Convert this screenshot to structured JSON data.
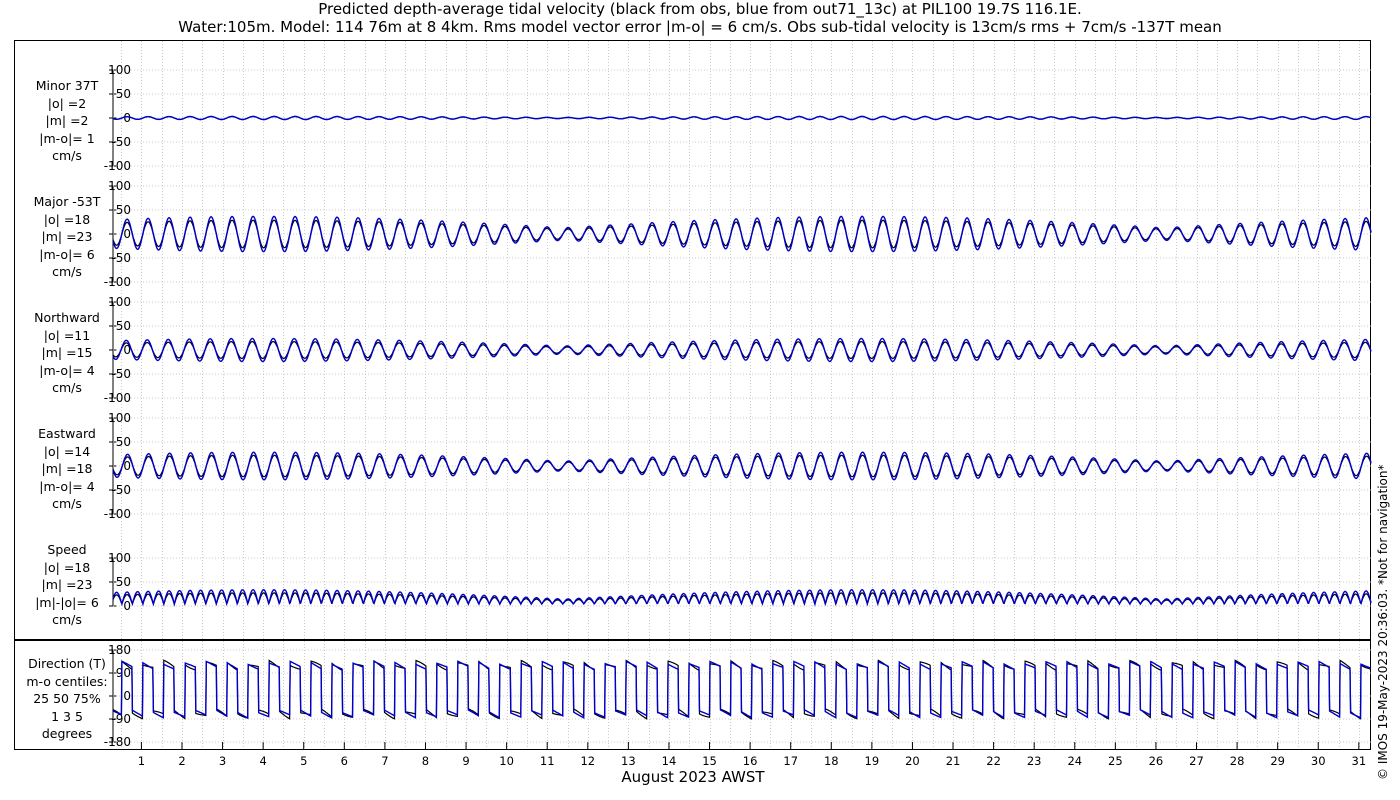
{
  "title_line1": "Predicted depth-average tidal velocity (black from obs, blue from out71_13c) at PIL100 19.7S 116.1E.",
  "title_line2": "Water:105m. Model: 114 76m at 8 4km. Rms model vector error |m-o| = 6 cm/s. Obs sub-tidal velocity is 13cm/s rms + 7cm/s -137T mean",
  "credit": "© IMOS 19-May-2023 20:36:03.  *Not for navigation*",
  "colors": {
    "obs": "#000000",
    "model": "#0000cc",
    "grid": "#bdbdbd",
    "axis": "#000000"
  },
  "chart_data": {
    "type": "line",
    "xlabel": "August 2023 AWST",
    "x_ticks": [
      "1",
      "2",
      "3",
      "4",
      "5",
      "6",
      "7",
      "8",
      "9",
      "10",
      "11",
      "12",
      "13",
      "14",
      "15",
      "16",
      "17",
      "18",
      "19",
      "20",
      "21",
      "22",
      "23",
      "24",
      "25",
      "26",
      "27",
      "28",
      "29",
      "30",
      "31"
    ],
    "xlim": [
      0.3,
      31.3
    ],
    "series": [
      {
        "name": "Obs",
        "color": "#000000"
      },
      {
        "name": "Model",
        "color": "#0000cc"
      }
    ],
    "panels": [
      {
        "key": "minor",
        "label": [
          "Minor 37T",
          "|o| =2",
          "|m| =2",
          "|m-o|= 1",
          "cm/s"
        ],
        "ylim": [
          -100,
          100
        ],
        "yticks": [
          100,
          50,
          0,
          -50,
          -100
        ],
        "yticklabels": [
          "100",
          "50",
          "0",
          "-50",
          "-100"
        ],
        "amp_obs": 2,
        "amp_model": 2
      },
      {
        "key": "major",
        "label": [
          "Major -53T",
          "|o| =18",
          "|m| =23",
          "|m-o|= 6",
          "cm/s"
        ],
        "ylim": [
          -100,
          100
        ],
        "yticks": [
          100,
          50,
          0,
          -50,
          -100
        ],
        "yticklabels": [
          "100",
          "50",
          "0",
          "-50",
          "-100"
        ],
        "amp_obs": 18,
        "amp_model": 23
      },
      {
        "key": "north",
        "label": [
          "Northward",
          "|o| =11",
          "|m| =15",
          "|m-o|= 4",
          "cm/s"
        ],
        "ylim": [
          -100,
          100
        ],
        "yticks": [
          100,
          50,
          0,
          -50,
          -100
        ],
        "yticklabels": [
          "100",
          "50",
          "0",
          "-50",
          "-100"
        ],
        "amp_obs": 11,
        "amp_model": 15
      },
      {
        "key": "east",
        "label": [
          "Eastward",
          "|o| =14",
          "|m| =18",
          "|m-o|= 4",
          "cm/s"
        ],
        "ylim": [
          -100,
          100
        ],
        "yticks": [
          100,
          50,
          0,
          -50,
          -100
        ],
        "yticklabels": [
          "100",
          "50",
          "0",
          "-50",
          "-100"
        ],
        "amp_obs": 14,
        "amp_model": 18
      },
      {
        "key": "speed",
        "label": [
          "Speed",
          "|o| =18",
          "|m| =23",
          "|m|-|o|= 6",
          "cm/s"
        ],
        "ylim": [
          0,
          100
        ],
        "yticks": [
          100,
          50,
          0
        ],
        "yticklabels": [
          "100",
          "50",
          "0"
        ],
        "amp_obs": 18,
        "amp_model": 23
      },
      {
        "key": "direction",
        "label": [
          "Direction (T)",
          "m-o centiles:",
          "25  50  75%",
          "1  3  5",
          "degrees"
        ],
        "ylim": [
          -180,
          180
        ],
        "yticks": [
          180,
          90,
          0,
          -90,
          -180
        ],
        "yticklabels": [
          "180",
          "90",
          "0",
          "-90",
          "-180"
        ]
      }
    ]
  }
}
